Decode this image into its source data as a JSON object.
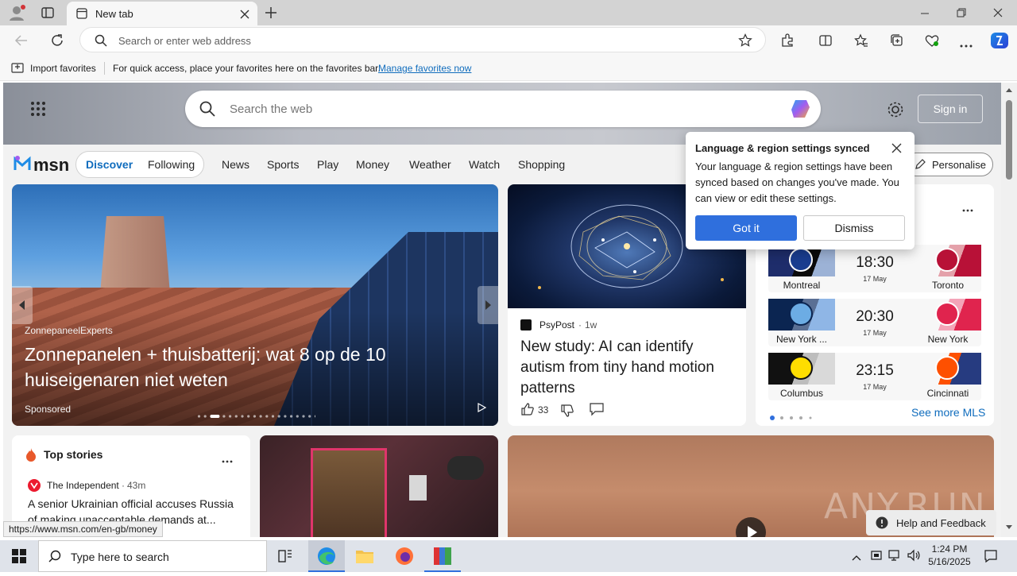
{
  "browser": {
    "tab_title": "New tab",
    "address_placeholder": "Search or enter web address",
    "favorites_bar": {
      "import_label": "Import favorites",
      "message": "For quick access, place your favorites here on the favorites bar.",
      "manage_link": "Manage favorites now"
    },
    "status_url": "https://www.msn.com/en-gb/money"
  },
  "msn": {
    "search_placeholder": "Search the web",
    "sign_in": "Sign in",
    "logo_text": "msn",
    "segment": [
      "Discover",
      "Following"
    ],
    "nav": [
      "News",
      "Sports",
      "Play",
      "Money",
      "Weather",
      "Watch",
      "Shopping"
    ],
    "personalise": "Personalise",
    "accent": "#2f6fdd"
  },
  "popup": {
    "title": "Language & region settings synced",
    "body": "Your language & region settings have been synced based on changes you've made. You can view or edit these settings.",
    "got_it": "Got it",
    "dismiss": "Dismiss"
  },
  "hero": {
    "source": "ZonnepaneelExperts",
    "headline": "Zonnepanelen + thuisbatterij: wat 8 op de 10 huiseigenaren niet weten",
    "sponsored": "Sponsored"
  },
  "article": {
    "source": "PsyPost",
    "age": "1w",
    "headline": "New study: AI can identify autism from tiny hand motion patterns",
    "likes": "33"
  },
  "mls": {
    "matches": [
      {
        "home": "Montreal",
        "away": "Toronto",
        "time": "18:30",
        "date": "17 May"
      },
      {
        "home": "New York ...",
        "away": "New York",
        "time": "20:30",
        "date": "17 May"
      },
      {
        "home": "Columbus",
        "away": "Cincinnati",
        "time": "23:15",
        "date": "17 May"
      }
    ],
    "see_more": "See more MLS"
  },
  "top_stories": {
    "title": "Top stories",
    "source": "The Independent",
    "age": "43m",
    "headline": "A senior Ukrainian official accuses Russia of making unacceptable demands at..."
  },
  "help": "Help and Feedback",
  "watermark": "ANY.RUN",
  "taskbar": {
    "search_placeholder": "Type here to search",
    "time": "1:24 PM",
    "date": "5/16/2025"
  }
}
